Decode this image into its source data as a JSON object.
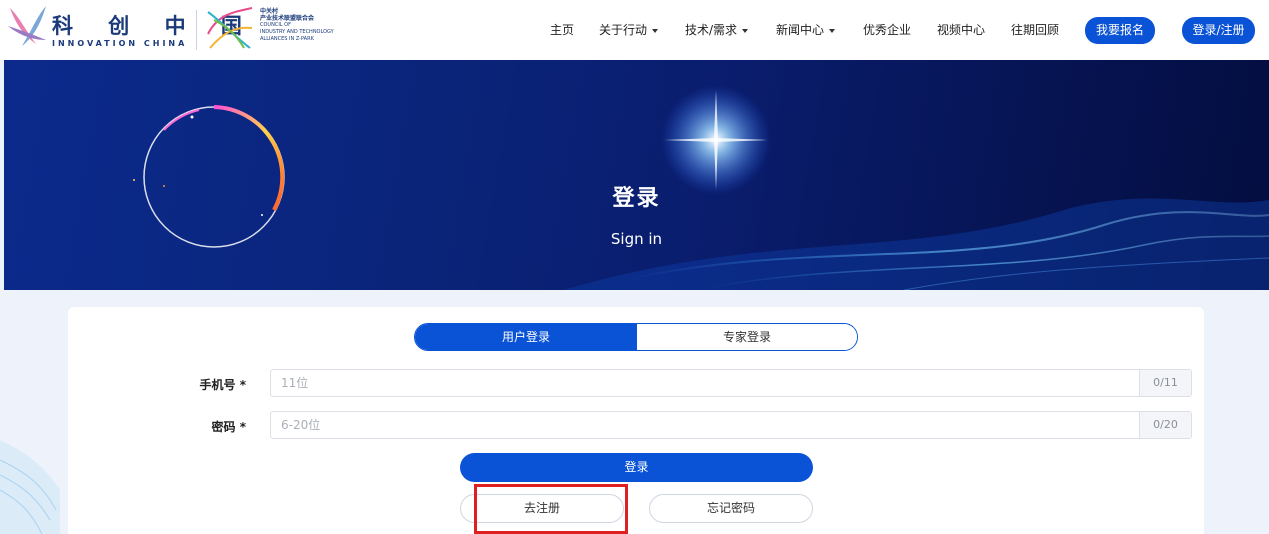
{
  "header": {
    "logo_cn": "科 创 中 国",
    "logo_en": "INNOVATION CHINA",
    "partner_lines": [
      "中关村",
      "产业技术联盟联合会",
      "COUNCIL OF",
      "INDUSTRY AND TECHNOLOGY",
      "ALLIANCES IN Z-PARK"
    ],
    "nav": [
      {
        "label": "主页",
        "dropdown": false
      },
      {
        "label": "关于行动",
        "dropdown": true
      },
      {
        "label": "技术/需求",
        "dropdown": true
      },
      {
        "label": "新闻中心",
        "dropdown": true
      },
      {
        "label": "优秀企业",
        "dropdown": false
      },
      {
        "label": "视频中心",
        "dropdown": false
      },
      {
        "label": "往期回顾",
        "dropdown": false
      }
    ],
    "register_event_label": "我要报名",
    "login_register_label": "登录/注册"
  },
  "banner": {
    "title": "登录",
    "subtitle": "Sign in"
  },
  "login": {
    "tabs": [
      {
        "label": "用户登录",
        "active": true
      },
      {
        "label": "专家登录",
        "active": false
      }
    ],
    "phone": {
      "label": "手机号 *",
      "placeholder": "11位",
      "value": "",
      "counter": "0/11"
    },
    "password": {
      "label": "密码 *",
      "placeholder": "6-20位",
      "value": "",
      "counter": "0/20"
    },
    "submit_label": "登录",
    "go_register_label": "去注册",
    "forgot_password_label": "忘记密码"
  },
  "colors": {
    "primary": "#0a53d6",
    "highlight": "#e02020",
    "banner_dark": "#061453"
  }
}
